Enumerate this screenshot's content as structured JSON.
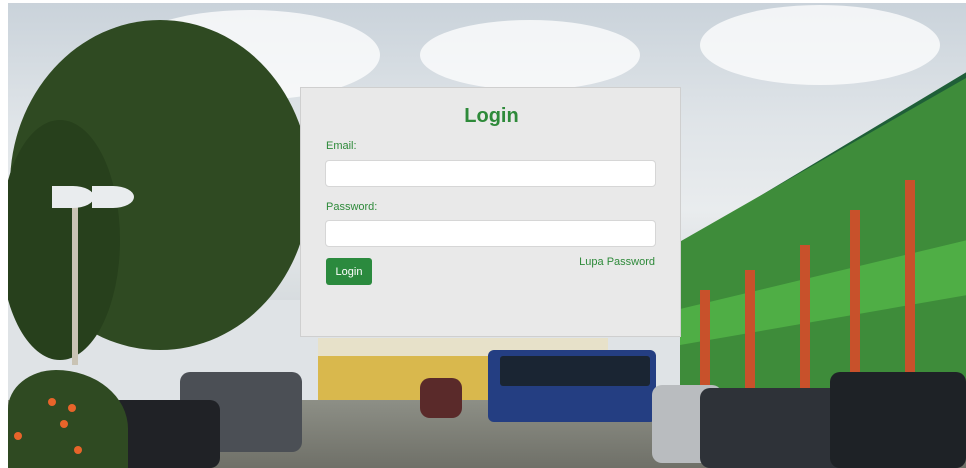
{
  "login": {
    "title": "Login",
    "email_label": "Email:",
    "email_value": "",
    "password_label": "Password:",
    "password_value": "",
    "submit_label": "Login",
    "forgot_password_label": "Lupa Password"
  },
  "background": {
    "icon": "school-campus-photo"
  },
  "colors": {
    "accent": "#2e8a3a",
    "button": "#2b8a3e",
    "card": "#e9e9e9"
  }
}
